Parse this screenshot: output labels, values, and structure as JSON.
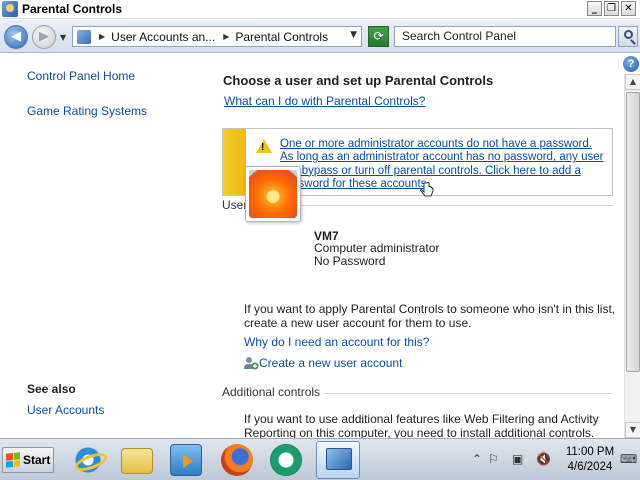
{
  "window": {
    "title": "Parental Controls"
  },
  "titlebar": {
    "minimize": "_",
    "restore": "❐",
    "close": "✕"
  },
  "address": {
    "segments": [
      "User Accounts an...",
      "Parental Controls"
    ]
  },
  "search": {
    "placeholder": "Search Control Panel"
  },
  "left_nav": {
    "home": "Control Panel Home",
    "game_rating": "Game Rating Systems",
    "see_also_heading": "See also",
    "user_accounts": "User Accounts"
  },
  "main": {
    "heading": "Choose a user and set up Parental Controls",
    "help_link": "What can I do with Parental Controls?",
    "warning": "One or more administrator accounts do not have a password. As long as an administrator account has no password, any user can bypass or turn off parental controls. Click here to add a password for these accounts.",
    "users_label": "Users",
    "user": {
      "name": "VM7",
      "type": "Computer administrator",
      "password": "No Password"
    },
    "info_text_1": "If you want to apply Parental Controls to someone who isn't in this list,",
    "info_text_2": "create a new user account for them to use.",
    "why_link": "Why do I need an account for this?",
    "create_link": "Create a new user account",
    "additional_label": "Additional controls",
    "additional_text_1": "If you want to use additional features like Web Filtering and Activity",
    "additional_text_2": "Reporting on this computer, you need to install additional controls."
  },
  "taskbar": {
    "start_label": "Start",
    "clock_time": "11:00 PM",
    "clock_date": "4/6/2024"
  },
  "colors": {
    "link": "#0b4aa8",
    "warning_stripe": "#f5cc2f"
  },
  "icons": [
    "back-icon",
    "forward-icon",
    "refresh-icon",
    "search-icon",
    "help-icon",
    "warning-icon",
    "add-user-icon",
    "windows-logo-icon",
    "internet-explorer-icon",
    "file-explorer-icon",
    "media-player-icon",
    "firefox-icon",
    "game-icon",
    "control-panel-icon",
    "flag-icon",
    "network-icon",
    "volume-muted-icon",
    "keyboard-icon"
  ]
}
